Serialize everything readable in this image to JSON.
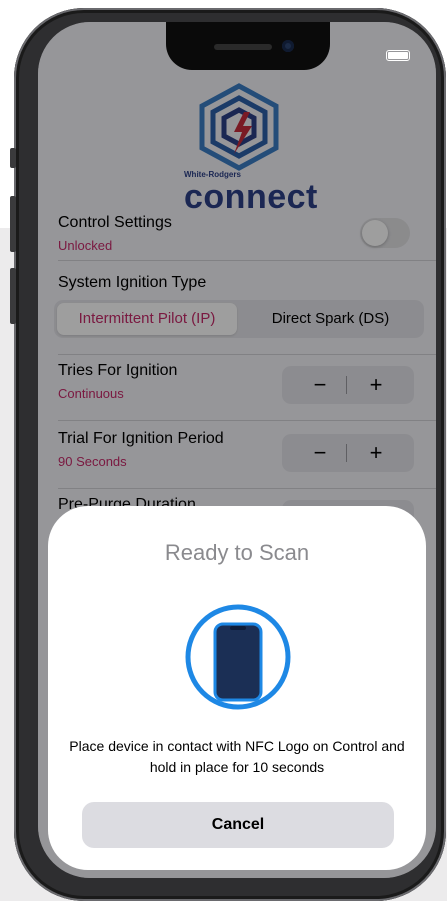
{
  "app": {
    "brand_small": "White-Rodgers",
    "brand_name": "connect"
  },
  "control_settings": {
    "label": "Control Settings",
    "status": "Unlocked",
    "toggle_on": false
  },
  "ignition_type": {
    "label": "System Ignition Type",
    "options": [
      "Intermittent Pilot (IP)",
      "Direct Spark (DS)"
    ],
    "selected": "Intermittent Pilot (IP)"
  },
  "tries_for_ignition": {
    "label": "Tries For Ignition",
    "value": "Continuous"
  },
  "trial_period": {
    "label": "Trial For Ignition Period",
    "value": "90 Seconds"
  },
  "pre_purge": {
    "label": "Pre-Purge Duration"
  },
  "stepper": {
    "minus": "−",
    "plus": "+"
  },
  "nfc_sheet": {
    "title": "Ready to Scan",
    "message": "Place device in contact with NFC Logo on Control and hold in place for 10 seconds",
    "cancel_label": "Cancel",
    "icon": "phone-nfc-icon"
  },
  "colors": {
    "accent": "#c62a6a",
    "brand": "#2c3f86",
    "nfc_blue": "#1e88e5"
  }
}
